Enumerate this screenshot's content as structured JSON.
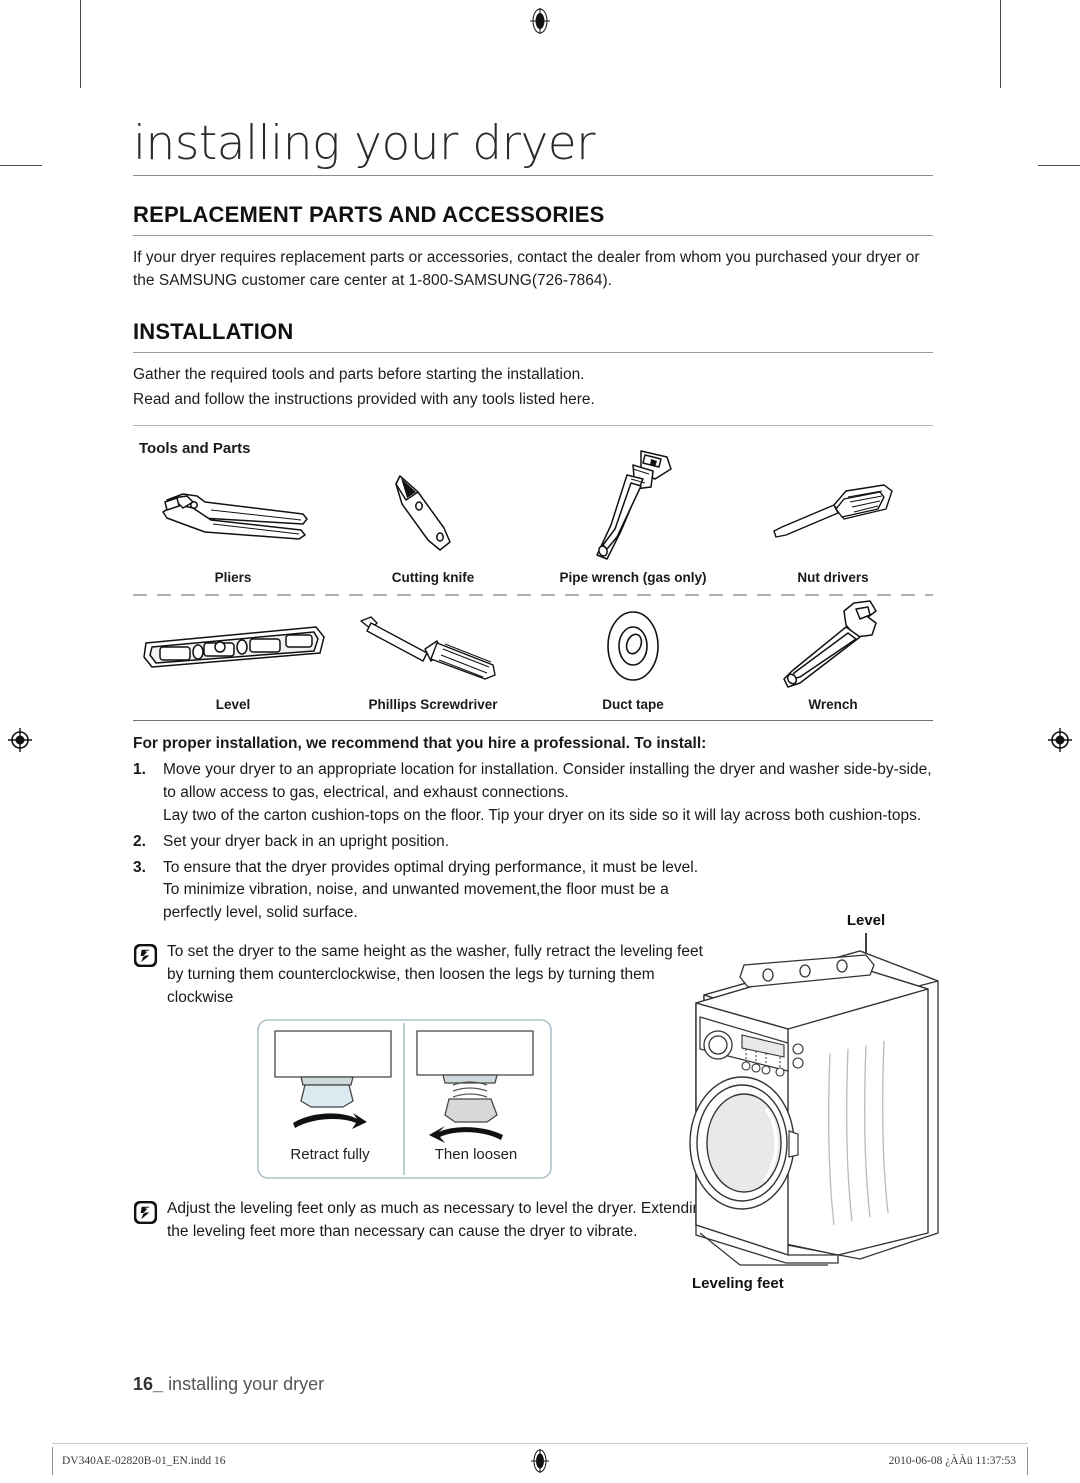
{
  "document": {
    "chapter_title": "installing your dryer",
    "footer_page_number": "16_",
    "footer_text": "installing your dryer"
  },
  "sections": {
    "replacement": {
      "heading": "REPLACEMENT PARTS AND ACCESSORIES",
      "body": "If your dryer requires replacement parts or accessories, contact the dealer from whom you purchased your dryer or the SAMSUNG customer care center at 1-800-SAMSUNG(726-7864)."
    },
    "installation": {
      "heading": "INSTALLATION",
      "body_line1": "Gather the required tools and parts before starting the installation.",
      "body_line2": "Read and follow the instructions provided with any tools listed here."
    }
  },
  "tools": {
    "heading": "Tools and Parts",
    "row1": [
      {
        "label": "Pliers",
        "icon": "pliers-icon"
      },
      {
        "label": "Cutting knife",
        "icon": "cutting-knife-icon"
      },
      {
        "label": "Pipe wrench (gas only)",
        "icon": "pipe-wrench-icon"
      },
      {
        "label": "Nut drivers",
        "icon": "nut-driver-icon"
      }
    ],
    "row2": [
      {
        "label": "Level",
        "icon": "level-icon"
      },
      {
        "label": "Phillips Screwdriver",
        "icon": "phillips-screwdriver-icon"
      },
      {
        "label": "Duct tape",
        "icon": "duct-tape-icon"
      },
      {
        "label": "Wrench",
        "icon": "wrench-icon"
      }
    ]
  },
  "instructions": {
    "lead": "For proper installation, we recommend that you hire a professional. To install:",
    "steps": [
      {
        "number": "1.",
        "paragraphs": [
          "Move your dryer to an appropriate location for installation. Consider installing the dryer and washer side-by-side, to allow access to gas, electrical, and exhaust connections.",
          "Lay two of the carton cushion-tops on the floor. Tip your dryer on its side so it will lay across both cushion-tops."
        ]
      },
      {
        "number": "2.",
        "paragraphs": [
          "Set your dryer back in an upright position."
        ]
      },
      {
        "number": "3.",
        "paragraphs": [
          "To ensure that the dryer provides optimal drying performance, it must be level. To minimize vibration, noise, and unwanted movement,the floor must be a perfectly level, solid surface."
        ]
      }
    ],
    "notes": [
      {
        "icon": "note-icon",
        "text": "To set the dryer to the same height as the washer, fully retract the leveling feet by turning them counterclockwise, then loosen the legs by turning them clockwise"
      },
      {
        "icon": "note-icon",
        "text": "Adjust the leveling feet only as much as necessary to level the dryer. Extending the leveling feet more than necessary can cause the dryer to vibrate."
      }
    ]
  },
  "figures": {
    "leveling_feet_panels": [
      {
        "caption": "Retract fully",
        "arrow": "arrow-clockwise-icon"
      },
      {
        "caption": "Then loosen",
        "arrow": "arrow-counterclockwise-icon"
      }
    ],
    "dryer": {
      "callout_top": "Level",
      "callout_bottom": "Leveling feet"
    }
  },
  "print_bar": {
    "file_name": "DV340AE-02820B-01_EN.indd   16",
    "timestamp": "2010-06-08   ¿ÀÀü 11:37:53"
  },
  "colors": {
    "text": "#1a1a1a",
    "rule": "#9a9a9a",
    "footer": "#555555",
    "panel_fill": "#d7e4ea"
  }
}
